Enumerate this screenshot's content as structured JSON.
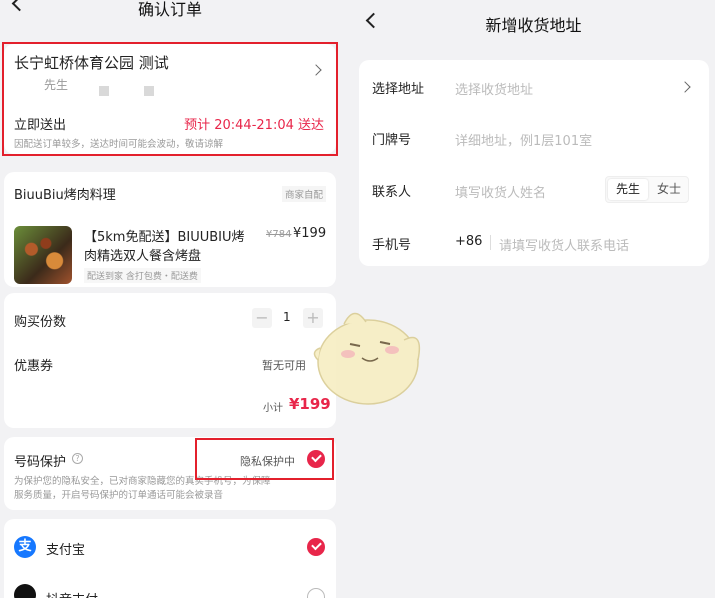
{
  "left": {
    "title": "确认订单",
    "address": {
      "name": "长宁虹桥体育公园 测试",
      "contact": "先生",
      "delivery_label": "立即送出",
      "eta": "预计 20:44-21:04 送达",
      "notice": "因配送订单较多，送达时间可能会波动，敬请谅解"
    },
    "shop": {
      "name": "BiuuBiu烤肉料理",
      "badge": "商家自配",
      "product_title_line1": "【5km免配送】BIUUBIU烤",
      "product_title_line2": "肉精选双人餐含烤盘",
      "original_price": "¥784",
      "price": "¥199",
      "tags": "配送到家   含打包费・配送费"
    },
    "quantity_label": "购买份数",
    "quantity": "1",
    "coupon_label": "优惠券",
    "coupon_value": "暂无可用",
    "subtotal_label": "小计",
    "subtotal": "¥199",
    "privacy": {
      "label": "号码保护",
      "status": "隐私保护中",
      "desc1": "为保护您的隐私安全，已对商家隐藏您的真实手机号，为保障",
      "desc2": "服务质量，开启号码保护的订单通话可能会被录音"
    },
    "payment": {
      "option1": "支付宝",
      "option2": "抖音支付"
    }
  },
  "right": {
    "title": "新增收货地址",
    "fields": {
      "address_label": "选择地址",
      "address_placeholder": "选择收货地址",
      "door_label": "门牌号",
      "door_placeholder": "详细地址，例1层101室",
      "contact_label": "联系人",
      "contact_placeholder": "填写收货人姓名",
      "gender_male": "先生",
      "gender_female": "女士",
      "phone_label": "手机号",
      "phone_prefix": "+86",
      "phone_placeholder": "请填写收货人联系电话"
    }
  },
  "colors": {
    "accent": "#e8264a",
    "highlight_box": "#e3202c",
    "alipay": "#1678ff"
  }
}
